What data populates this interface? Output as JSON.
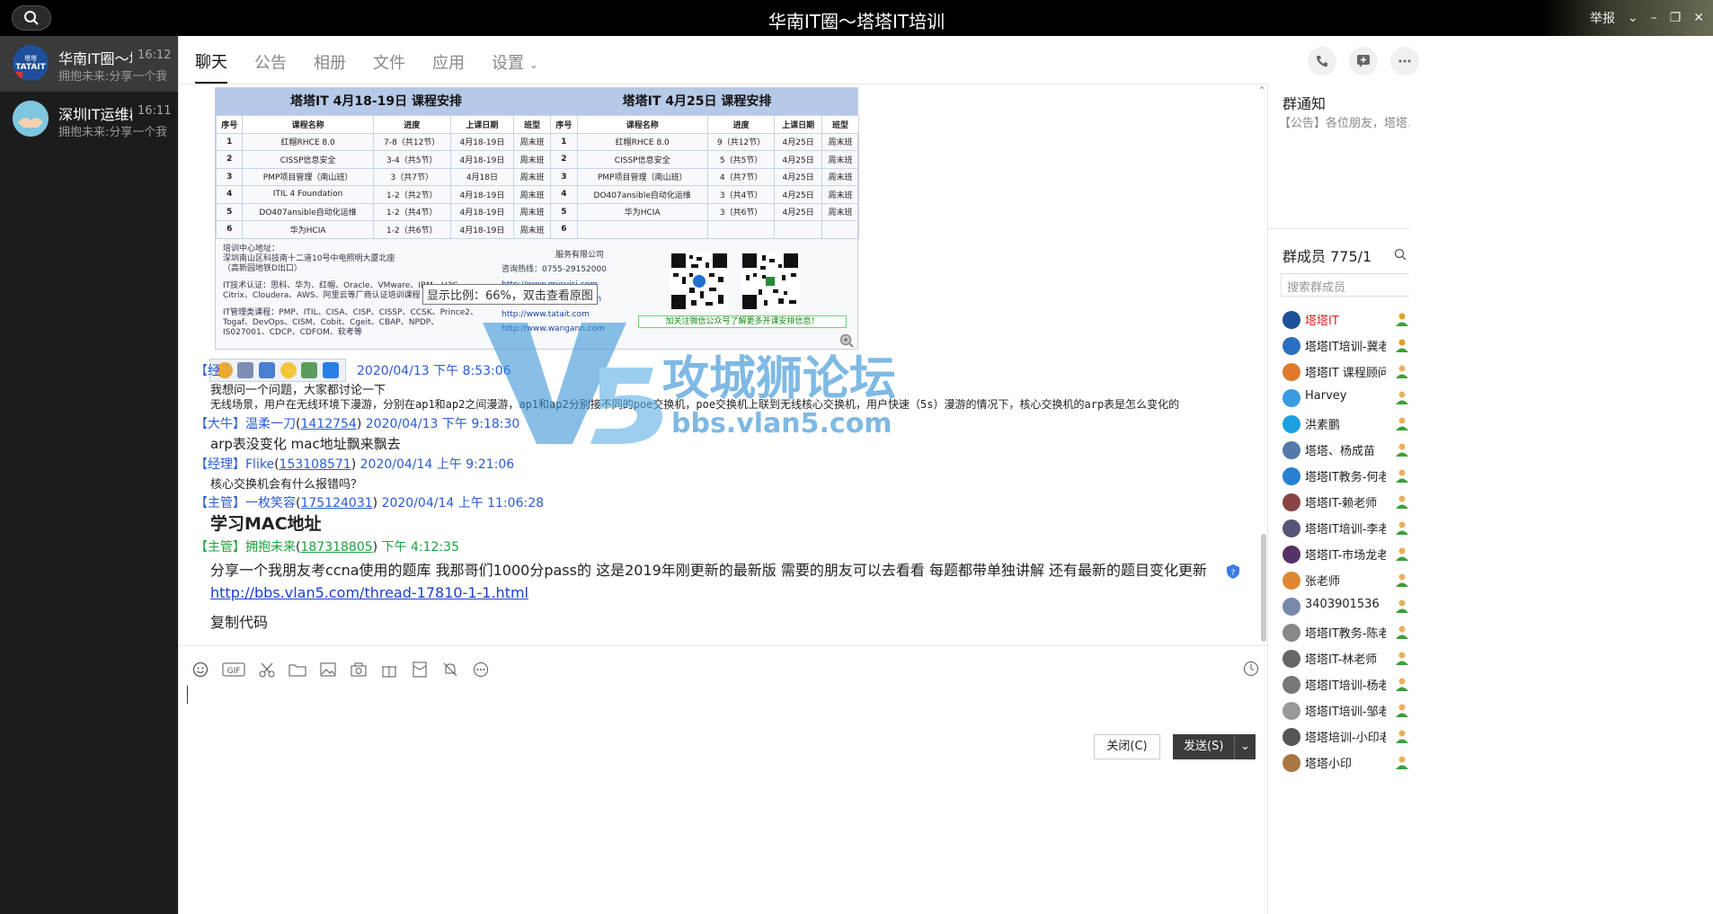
{
  "window": {
    "title": "华南IT圈～塔塔IT培训",
    "report_label": "举报",
    "controls": [
      "minimize",
      "maximize",
      "close"
    ]
  },
  "sidebar": {
    "items": [
      {
        "name": "华南IT圈～塔塔IT培训",
        "time": "16:12",
        "preview": "拥抱未来:分享一个我朋友",
        "active": true
      },
      {
        "name": "深圳IT运维群",
        "time": "16:11",
        "preview": "拥抱未来:分享一个我朋友",
        "active": false
      }
    ]
  },
  "tabs": [
    "聊天",
    "公告",
    "相册",
    "文件",
    "应用",
    "设置"
  ],
  "schedule": {
    "left_title": "塔塔IT 4月18-19日 课程安排",
    "right_title": "塔塔IT 4月25日 课程安排",
    "headers": [
      "序号",
      "课程名称",
      "进度",
      "上课日期",
      "班型"
    ],
    "left_rows": [
      [
        "1",
        "红帽RHCE 8.0",
        "7-8（共12节）",
        "4月18-19日",
        "周末班"
      ],
      [
        "2",
        "CISSP信息安全",
        "3-4（共5节）",
        "4月18-19日",
        "周末班"
      ],
      [
        "3",
        "PMP项目管理（南山班）",
        "3（共7节）",
        "4月18日",
        "周末班"
      ],
      [
        "4",
        "ITIL 4 Foundation",
        "1-2（共2节）",
        "4月18-19日",
        "周末班"
      ],
      [
        "5",
        "DO407ansible自动化运维",
        "1-2（共4节）",
        "4月18-19日",
        "周末班"
      ],
      [
        "6",
        "华为HCIA",
        "1-2（共6节）",
        "4月18-19日",
        "周末班"
      ]
    ],
    "right_rows": [
      [
        "1",
        "红帽RHCE 8.0",
        "9（共12节）",
        "4月25日",
        "周末班"
      ],
      [
        "2",
        "CISSP信息安全",
        "5（共5节）",
        "4月25日",
        "周末班"
      ],
      [
        "3",
        "PMP项目管理（南山班）",
        "4（共7节）",
        "4月25日",
        "周末班"
      ],
      [
        "4",
        "DO407ansible自动化运维",
        "3（共4节）",
        "4月25日",
        "周末班"
      ],
      [
        "5",
        "华为HCIA",
        "3（共6节）",
        "4月25日",
        "周末班"
      ],
      [
        "6",
        "",
        "",
        "",
        ""
      ]
    ],
    "address_label": "培训中心地址：",
    "address": "深圳南山区科技南十二道10号中电照明大厦北座",
    "address_note": "（高新园地铁D出口）",
    "certs": "IT技术认证：思科、华为、红帽、Oracle、VMware、IBM、H3C、Citrix、Cloudera、AWS、阿里云等厂商认证培训课程",
    "mgmt": "IT管理类课程：PMP、ITIL、CISA、CISP、CISSP、CCSK、Prince2、Togaf、DevOps、CISM、Cobit、Cgeit、CBAP、NPDP、IS027001、CDCP、CDFOM、软考等",
    "company_suffix": "服务有限公司",
    "hotline": "咨询热线：0755-29152000",
    "links": [
      "http://www.myruisi.com",
      "http://www.pmp100.com",
      "http://www.tatait.com",
      "http://www.wangann.com"
    ],
    "qr_caption": "加关注微信公众号了解更多开课安排信息！"
  },
  "image_tooltip": "显示比例：66%，双击查看原图",
  "watermark": {
    "logo_text": "V5",
    "title": "攻城狮论坛",
    "url": "bbs.vlan5.com"
  },
  "messages": [
    {
      "role": "【经理】",
      "nick": "",
      "qq": "",
      "time": "2020/04/13 下午 8:53:06",
      "green": false,
      "lines": [
        "我想问一个问题，大家都讨论一下",
        "无线场景，用户在无线环境下漫游，分别在ap1和ap2之间漫游，ap1和ap2分别接不同的poe交换机，poe交换机上联到无线核心交换机，用户快速（5s）漫游的情况下，核心交换机的arp表是怎么变化的"
      ]
    },
    {
      "role": "【大牛】",
      "nick": "温柔一刀",
      "qq": "1412754",
      "time": "2020/04/13 下午 9:18:30",
      "green": false,
      "lines": [
        "arp表没变化  mac地址飘来飘去"
      ]
    },
    {
      "role": "【经理】",
      "nick": "Flike",
      "qq": "153108571",
      "time": "2020/04/14 上午 9:21:06",
      "green": false,
      "lines": [
        "核心交换机会有什么报错吗？"
      ]
    },
    {
      "role": "【主管】",
      "nick": "一枚笑容",
      "qq": "175124031",
      "time": "2020/04/14 上午 11:06:28",
      "green": false,
      "lines": [
        "学习MAC地址"
      ]
    },
    {
      "role": "【主管】",
      "nick": "拥抱未来",
      "qq": "187318805",
      "time": "下午 4:12:35",
      "green": true,
      "lines": [
        "分享一个我朋友考ccna使用的题库 我那哥们1000分pass的 这是2019年刚更新的最新版 需要的朋友可以去看看 每题都带单独讲解 还有最新的题目变化更新",
        "http://bbs.vlan5.com/thread-17810-1-1.html",
        "复制代码"
      ]
    }
  ],
  "composer": {
    "tools": [
      "emoji-icon",
      "gif-icon",
      "scissors-icon",
      "folder-icon",
      "image-icon",
      "camera-icon",
      "gift-icon",
      "red-packet-icon",
      "bell-off-icon",
      "more-icon"
    ],
    "close_label": "关闭(C)",
    "send_label": "发送(S)"
  },
  "right_panel": {
    "notice_title": "群通知",
    "notice_text": "【公告】各位朋友，塔塔...",
    "members_title": "群成员 775/1",
    "search_placeholder": "搜索群成员",
    "members": [
      {
        "name": "塔塔IT",
        "highlight": true
      },
      {
        "name": "塔塔IT培训-冀老师",
        "highlight": false
      },
      {
        "name": "塔塔IT 课程顾问",
        "highlight": false
      },
      {
        "name": "Harvey",
        "highlight": false
      },
      {
        "name": "洪素鹏",
        "highlight": false
      },
      {
        "name": "塔塔、杨成苗",
        "highlight": false
      },
      {
        "name": "塔塔IT教务-何老师",
        "highlight": false
      },
      {
        "name": "塔塔IT-赖老师",
        "highlight": false
      },
      {
        "name": "塔塔IT培训-李老师",
        "highlight": false
      },
      {
        "name": "塔塔IT-市场龙老师",
        "highlight": false
      },
      {
        "name": "张老师",
        "highlight": false
      },
      {
        "name": "3403901536",
        "highlight": false
      },
      {
        "name": "塔塔IT教务-陈老师",
        "highlight": false
      },
      {
        "name": "塔塔IT-林老师",
        "highlight": false
      },
      {
        "name": "塔塔IT培训-杨老师",
        "highlight": false
      },
      {
        "name": "塔塔IT培训-邹老师",
        "highlight": false
      },
      {
        "name": "塔塔培训-小印老师",
        "highlight": false
      },
      {
        "name": "塔塔小印",
        "highlight": false
      }
    ]
  }
}
